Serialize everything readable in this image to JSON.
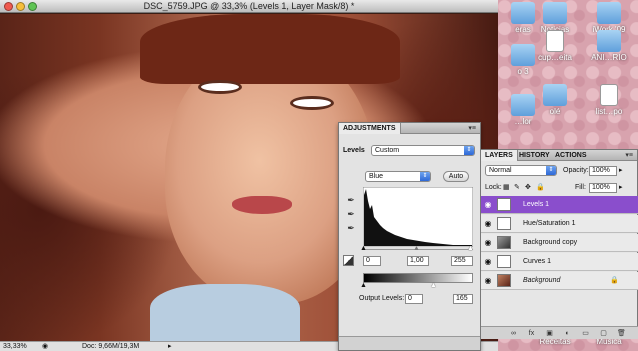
{
  "window": {
    "title": "DSC_5759.JPG @ 33,3% (Levels 1, Layer Mask/8) *",
    "zoom": "33,33%",
    "doc_size": "Doc: 9,66M/19,3M"
  },
  "desktop": {
    "icons": [
      {
        "label": "eras",
        "kind": "folder"
      },
      {
        "label": "Noticias",
        "kind": "folder"
      },
      {
        "label": "iWork '09",
        "kind": "folder"
      },
      {
        "label": "o 3",
        "kind": "folder"
      },
      {
        "label": "cup…eita",
        "kind": "doc"
      },
      {
        "label": "ANI…RIO",
        "kind": "folder"
      },
      {
        "label": "…lor",
        "kind": "folder"
      },
      {
        "label": "olé",
        "kind": "folder"
      },
      {
        "label": "list…po",
        "kind": "doc"
      },
      {
        "label": "Receitas",
        "kind": "folder"
      },
      {
        "label": "Musica",
        "kind": "folder"
      }
    ]
  },
  "adjustments": {
    "tab": "ADJUSTMENTS",
    "menu_icon": "▾≡",
    "preset_label": "Levels",
    "preset_value": "Custom",
    "channel_value": "Blue",
    "auto_label": "Auto",
    "input_black": "0",
    "input_gamma": "1,00",
    "input_white": "255",
    "output_label": "Output Levels:",
    "output_black": "0",
    "output_white": "165"
  },
  "layers_panel": {
    "tabs": [
      "LAYERS",
      "HISTORY",
      "ACTIONS"
    ],
    "blend_mode": "Normal",
    "opacity_label": "Opacity:",
    "opacity_value": "100%",
    "lock_label": "Lock:",
    "fill_label": "Fill:",
    "fill_value": "100%",
    "layers": [
      {
        "name": "Levels 1",
        "type": "adjustment",
        "active": true,
        "italic": false
      },
      {
        "name": "Hue/Saturation 1",
        "type": "adjustment",
        "active": false,
        "italic": false
      },
      {
        "name": "Background copy",
        "type": "image",
        "active": false,
        "italic": false
      },
      {
        "name": "Curves 1",
        "type": "adjustment",
        "active": false,
        "italic": false
      },
      {
        "name": "Background",
        "type": "image",
        "active": false,
        "italic": true
      }
    ],
    "footer_icons": [
      "link-icon",
      "fx-icon",
      "mask-icon",
      "adjustment-icon",
      "group-icon",
      "new-layer-icon",
      "trash-icon"
    ]
  },
  "colors": {
    "active_layer": "#8a4ecc",
    "select_blue": "#2d68d6"
  }
}
